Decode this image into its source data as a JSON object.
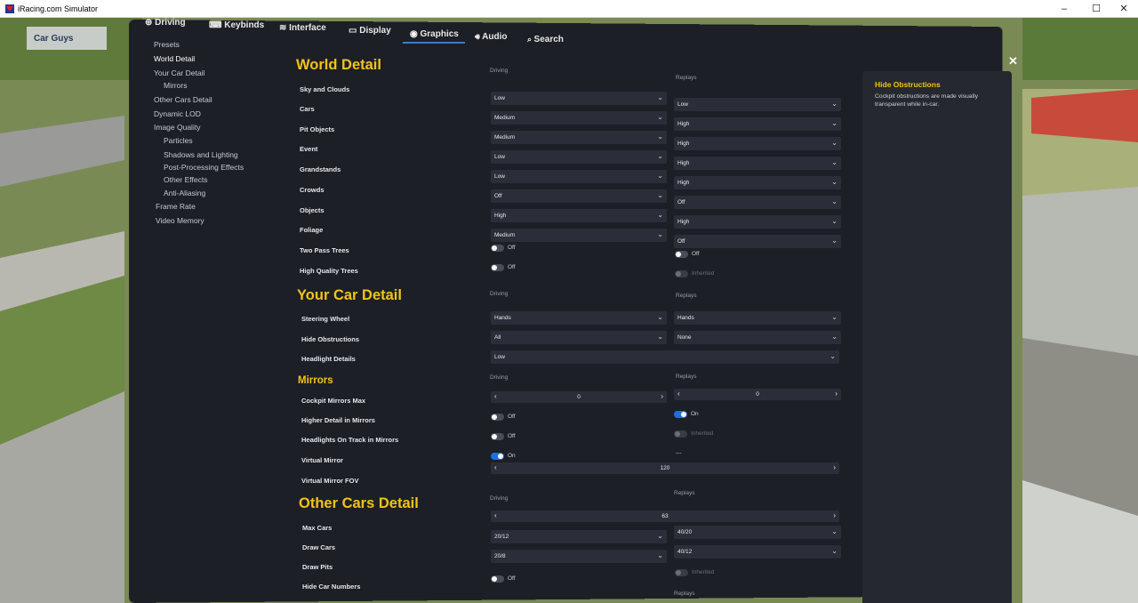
{
  "window": {
    "title": "iRacing.com Simulator",
    "min": "–",
    "max": "☐",
    "close": "✕"
  },
  "background": {
    "banner": "Car Guys"
  },
  "nav": {
    "tabs": [
      {
        "label": "Driving",
        "icon": "steering-wheel-icon"
      },
      {
        "label": "Keybinds",
        "icon": "keybinds-icon"
      },
      {
        "label": "Interface",
        "icon": "layers-icon"
      },
      {
        "label": "Display",
        "icon": "monitor-icon"
      },
      {
        "label": "Graphics",
        "icon": "graphics-icon",
        "active": true
      },
      {
        "label": "Audio",
        "icon": "speaker-icon"
      },
      {
        "label": "Search",
        "icon": "search-icon"
      }
    ],
    "active_color": "#3a7bd5"
  },
  "sidebar": {
    "items": [
      "Presets",
      "World Detail",
      "Your Car Detail",
      "Mirrors",
      "Other Cars Detail",
      "Dynamic LOD",
      "Image Quality",
      "Particles",
      "Shadows and Lighting",
      "Post-Processing Effects",
      "Other Effects",
      "Anti-Aliasing",
      "Frame Rate",
      "Video Memory"
    ]
  },
  "sections": {
    "world": "World Detail",
    "car": "Your Car Detail",
    "mirrors": "Mirrors",
    "other": "Other Cars Detail"
  },
  "col": {
    "driving": "Driving",
    "replays": "Replays"
  },
  "world_rows": [
    {
      "label": "Sky and Clouds",
      "driving": "Low",
      "replays": "Low"
    },
    {
      "label": "Cars",
      "driving": "Medium",
      "replays": "High"
    },
    {
      "label": "Pit Objects",
      "driving": "Medium",
      "replays": "High"
    },
    {
      "label": "Event",
      "driving": "Low",
      "replays": "High"
    },
    {
      "label": "Grandstands",
      "driving": "Low",
      "replays": "High"
    },
    {
      "label": "Crowds",
      "driving": "Off",
      "replays": "Off"
    },
    {
      "label": "Objects",
      "driving": "High",
      "replays": "High"
    },
    {
      "label": "Foliage",
      "driving": "Medium",
      "replays": "Off"
    },
    {
      "label": "Two Pass Trees",
      "driving": "Off",
      "replays": "Off"
    },
    {
      "label": "High Quality Trees",
      "driving": "Off",
      "replays": "Inherited"
    }
  ],
  "car_rows": [
    {
      "label": "Steering Wheel",
      "driving": "Hands",
      "replays": "Hands"
    },
    {
      "label": "Hide Obstructions",
      "driving": "All",
      "replays": "None"
    },
    {
      "label": "Headlight Details",
      "driving": "Low"
    }
  ],
  "mirror_rows": [
    {
      "label": "Cockpit Mirrors Max",
      "driving": "0",
      "replays": "0"
    },
    {
      "label": "Higher Detail in Mirrors",
      "driving": "Off",
      "replays": "On"
    },
    {
      "label": "Headlights On Track in Mirrors",
      "driving": "Off",
      "replays": "Inherited"
    },
    {
      "label": "Virtual Mirror",
      "driving": "On",
      "replays": "---"
    },
    {
      "label": "Virtual Mirror FOV",
      "driving": "120"
    }
  ],
  "other_rows": [
    {
      "label": "Max Cars",
      "driving": "63"
    },
    {
      "label": "Draw Cars",
      "driving": "20/12",
      "replays": "40/20"
    },
    {
      "label": "Draw Pits",
      "driving": "20/8",
      "replays": "40/12"
    },
    {
      "label": "Hide Car Numbers",
      "driving": "Off",
      "replays": "Inherited"
    }
  ],
  "help": {
    "title": "Hide Obstructions",
    "text": "Cockpit obstructions are made visually transparent while in-car."
  },
  "colors": {
    "accent": "#f3c318",
    "toggle_on": "#1c6fe0",
    "panel": "#1d1f26"
  }
}
